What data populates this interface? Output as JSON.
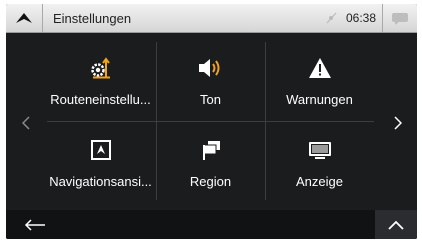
{
  "header": {
    "title": "Einstellungen",
    "time": "06:38"
  },
  "tiles": [
    {
      "label": "Routeneinstellu..."
    },
    {
      "label": "Ton"
    },
    {
      "label": "Warnungen"
    },
    {
      "label": "Navigationsansi..."
    },
    {
      "label": "Region"
    },
    {
      "label": "Anzeige"
    }
  ],
  "colors": {
    "accent": "#f2a21b",
    "background": "#1b1c1e",
    "header": "#e4e4e4"
  }
}
